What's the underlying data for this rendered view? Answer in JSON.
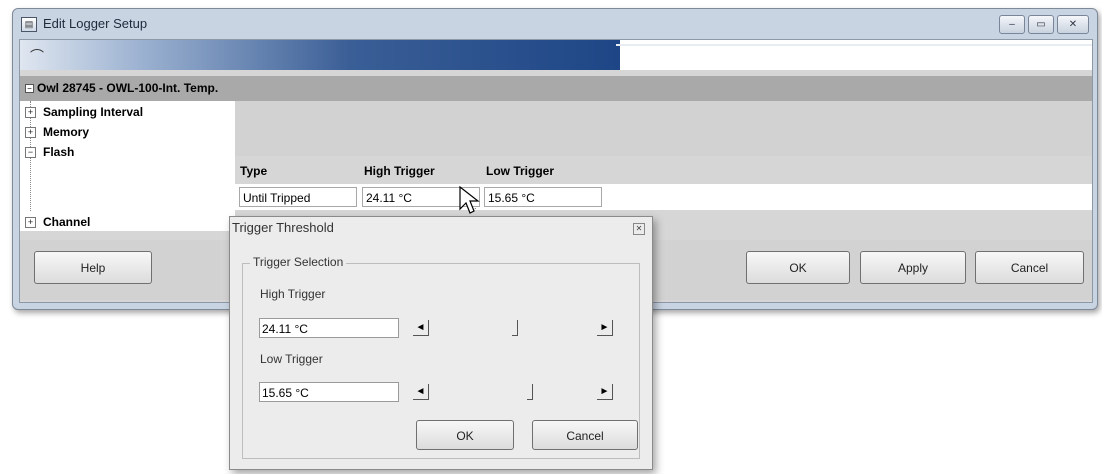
{
  "window": {
    "title": "Edit Logger Setup",
    "caption_buttons": [
      "–",
      "▭",
      "✕"
    ]
  },
  "progress": {
    "value_fraction": 0.56
  },
  "group": {
    "toggle": "−",
    "label": "Owl 28745 - OWL-100-Int. Temp."
  },
  "tree": {
    "items": [
      {
        "toggle": "+",
        "label": "Sampling Interval"
      },
      {
        "toggle": "+",
        "label": "Memory"
      },
      {
        "toggle": "−",
        "label": "Flash"
      },
      {
        "toggle": "+",
        "label": "Channel"
      }
    ]
  },
  "flash": {
    "headers": {
      "type": "Type",
      "high": "High Trigger",
      "low": "Low Trigger"
    },
    "values": {
      "type": "Until Tripped",
      "high": "24.11 °C",
      "low": "15.65 °C"
    },
    "ellipsis": "..."
  },
  "buttons": {
    "help": "Help",
    "ok": "OK",
    "apply": "Apply",
    "cancel": "Cancel"
  },
  "popup": {
    "title": "Trigger Threshold",
    "close": "✕",
    "group_label": "Trigger Selection",
    "high_label": "High Trigger",
    "high_value": "24.11 °C",
    "low_label": "Low Trigger",
    "low_value": "15.65 °C",
    "ok": "OK",
    "cancel": "Cancel"
  },
  "icons": {
    "left_arrow": "◄",
    "right_arrow": "►"
  }
}
